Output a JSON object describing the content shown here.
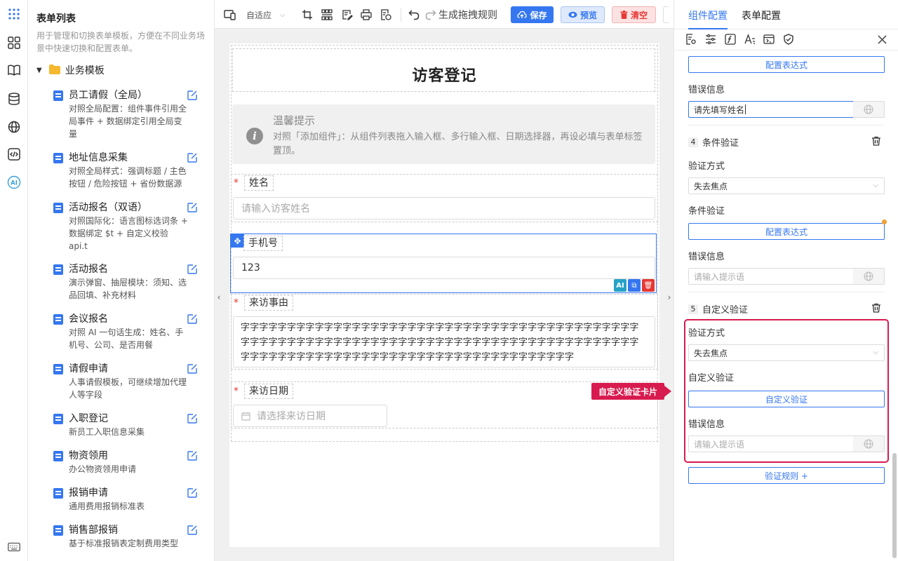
{
  "sidebar_panel": {
    "title": "表单列表",
    "description": "用于管理和切换表单模板，方便在不同业务场景中快速切换和配置表单。",
    "group_label": "业务模板",
    "items": [
      {
        "name": "员工请假（全局）",
        "desc": "对照全局配置：组件事件引用全局事件 + 数据绑定引用全局变量"
      },
      {
        "name": "地址信息采集",
        "desc": "对照全局样式：强调标题 / 主色按钮 / 危险按钮 + 省份数据源"
      },
      {
        "name": "活动报名（双语）",
        "desc": "对照国际化：语言图标选词条 + 数据绑定 $t + 自定义校验 api.t"
      },
      {
        "name": "活动报名",
        "desc": "演示弹窗、抽屉模块：须知、选品回填、补充材料"
      },
      {
        "name": "会议报名",
        "desc": "对照 AI 一句话生成：姓名、手机号、公司、是否用餐"
      },
      {
        "name": "请假申请",
        "desc": "人事请假模板，可继续增加代理人等字段"
      },
      {
        "name": "入职登记",
        "desc": "新员工入职信息采集"
      },
      {
        "name": "物资领用",
        "desc": "办公物资领用申请"
      },
      {
        "name": "报销申请",
        "desc": "通用费用报销标准表"
      },
      {
        "name": "销售部报销",
        "desc": "基于标准报销表定制费用类型"
      }
    ]
  },
  "toolbar": {
    "layout_select": "自适应",
    "generate_rules": "生成拖拽规则",
    "save": "保存",
    "preview": "预览",
    "clear": "清空"
  },
  "form": {
    "title": "访客登记",
    "alert_title": "温馨提示",
    "alert_body": "对照「添加组件」：从组件列表拖入输入框、多行输入框、日期选择器，再设必填与表单标签置顶。",
    "name_label": "姓名",
    "name_placeholder": "请输入访客姓名",
    "phone_label": "手机号",
    "phone_value": "123",
    "reason_label": "来访事由",
    "reason_value": "字字字字字字字字字字字字字字字字字字字字字字字字字字字字字字字字字字字字字字字字字字字字字字字字字字字字字字字字字字字字字字字字字字字字字字字字字字字字字字字字字字字字字字字字字字字字字字字字字字字字字字字字字字字字字字字字字字字字字字字字字字",
    "date_label": "来访日期",
    "date_placeholder": "请选择来访日期",
    "required_mark": "*",
    "ai_badge": "AI"
  },
  "props_panel": {
    "tab_component": "组件配置",
    "tab_form": "表单配置",
    "config_expression": "配置表达式",
    "error_info": "错误信息",
    "error_value_1": "请先填写姓名",
    "rule4_num": "4",
    "rule4_title": "条件验证",
    "validate_method": "验证方式",
    "method_value": "失去焦点",
    "condition_validate": "条件验证",
    "config_expression_2": "配置表达式",
    "error_info_2": "错误信息",
    "error_placeholder": "请输入提示语",
    "rule5_num": "5",
    "rule5_title": "自定义验证",
    "validate_method_2": "验证方式",
    "method_value_2": "失去焦点",
    "custom_validate": "自定义验证",
    "custom_validate_btn": "自定义验证",
    "error_info_3": "错误信息",
    "error_placeholder_3": "请输入提示语",
    "add_rule": "验证规则 +"
  },
  "callout": "自定义验证卡片",
  "colors": {
    "primary": "#3577f0",
    "danger": "#e53935",
    "highlight": "#d81b4f"
  }
}
